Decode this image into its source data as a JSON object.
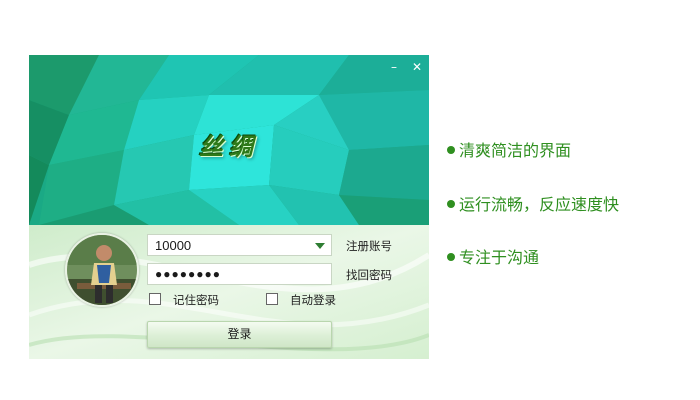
{
  "window": {
    "title": "丝绸",
    "minimize_icon": "minimize-icon",
    "close_icon": "close-icon",
    "minimize_glyph": "–",
    "close_glyph": "✕"
  },
  "login": {
    "avatar_icon": "user-avatar",
    "account_value": "10000",
    "password_mask": "●●●●●●●●",
    "register_link": "注册账号",
    "find_password_link": "找回密码",
    "remember_label": "记住密码",
    "auto_login_label": "自动登录",
    "login_button": "登录"
  },
  "features": [
    "清爽简洁的界面",
    "运行流畅，反应速度快",
    "专注于沟通"
  ],
  "colors": {
    "banner_teal": "#1fc7b6",
    "banner_green": "#1e9b5f",
    "feature_green": "#2f8f20",
    "panel_bg": "#e3f3df"
  }
}
